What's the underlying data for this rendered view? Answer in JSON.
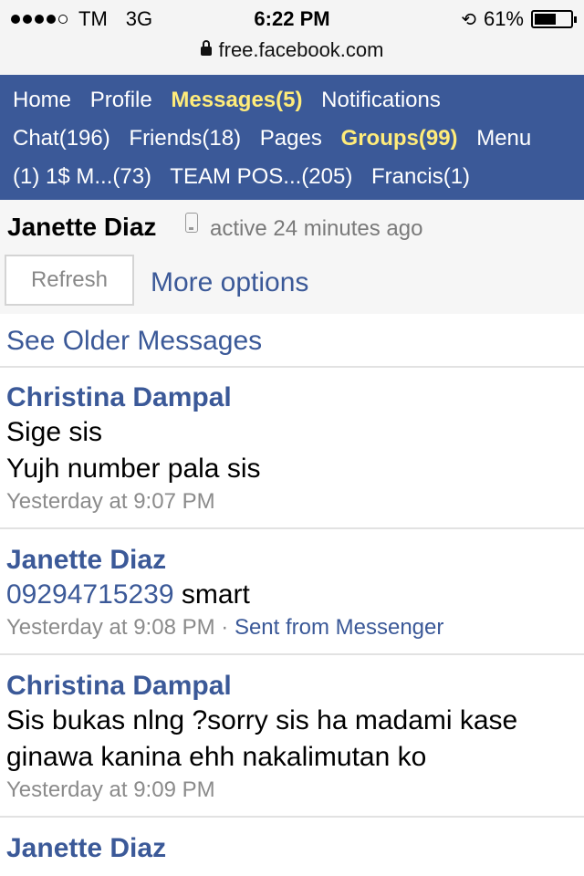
{
  "status_bar": {
    "carrier": "TM",
    "network": "3G",
    "time": "6:22 PM",
    "battery": "61%",
    "battery_level": 0.61
  },
  "browser": {
    "url": "free.facebook.com"
  },
  "nav": {
    "row1": [
      "Home",
      "Profile",
      "Messages(5)",
      "Notifications"
    ],
    "row2": [
      "Chat(196)",
      "Friends(18)",
      "Pages",
      "Groups(99)",
      "Menu"
    ],
    "row3": [
      "(1) 1$ M...(73)",
      "TEAM POS...(205)",
      "Francis(1)"
    ]
  },
  "thread": {
    "name": "Janette Diaz",
    "status": "active 24 minutes ago",
    "refresh_label": "Refresh",
    "more_options_label": "More options",
    "older_label": "See Older Messages"
  },
  "messages": [
    {
      "sender": "Christina Dampal",
      "lines": [
        "Sige sis",
        "Yujh number pala sis"
      ],
      "time": "Yesterday at 9:07 PM"
    },
    {
      "sender": "Janette Diaz",
      "number": "09294715239",
      "text_after": "smart",
      "time": "Yesterday at 9:08 PM",
      "separator": "·",
      "via": "Sent from Messenger"
    },
    {
      "sender": "Christina Dampal",
      "lines": [
        "Sis bukas nlng ?sorry sis ha madami kase",
        "ginawa kanina ehh nakalimutan ko"
      ],
      "time": "Yesterday at 9:09 PM"
    },
    {
      "sender": "Janette Diaz"
    }
  ]
}
